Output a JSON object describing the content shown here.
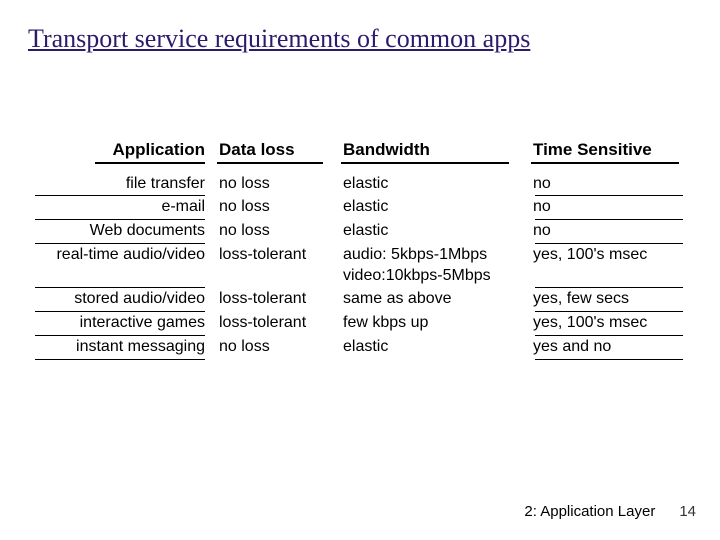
{
  "title": "Transport service requirements of common apps",
  "headers": {
    "application": "Application",
    "data_loss": "Data loss",
    "bandwidth": "Bandwidth",
    "time_sensitive": "Time Sensitive"
  },
  "rows": [
    {
      "app": "file transfer",
      "loss": "no loss",
      "bw": "elastic",
      "time": "no"
    },
    {
      "app": "e-mail",
      "loss": "no loss",
      "bw": "elastic",
      "time": "no"
    },
    {
      "app": "Web documents",
      "loss": "no loss",
      "bw": "elastic",
      "time": "no"
    },
    {
      "app": "real-time audio/video",
      "loss": "loss-tolerant",
      "bw": "audio: 5kbps-1Mbps",
      "time": "yes, 100's msec"
    },
    {
      "app": "",
      "loss": "",
      "bw": "video:10kbps-5Mbps",
      "time": ""
    },
    {
      "app": "stored audio/video",
      "loss": "loss-tolerant",
      "bw": "same as above",
      "time": "yes, few secs"
    },
    {
      "app": "interactive games",
      "loss": "loss-tolerant",
      "bw": "few kbps up",
      "time": "yes, 100's msec"
    },
    {
      "app": "instant messaging",
      "loss": "no loss",
      "bw": "elastic",
      "time": "yes and no"
    }
  ],
  "footer": {
    "section": "2: Application Layer",
    "page": "14"
  }
}
